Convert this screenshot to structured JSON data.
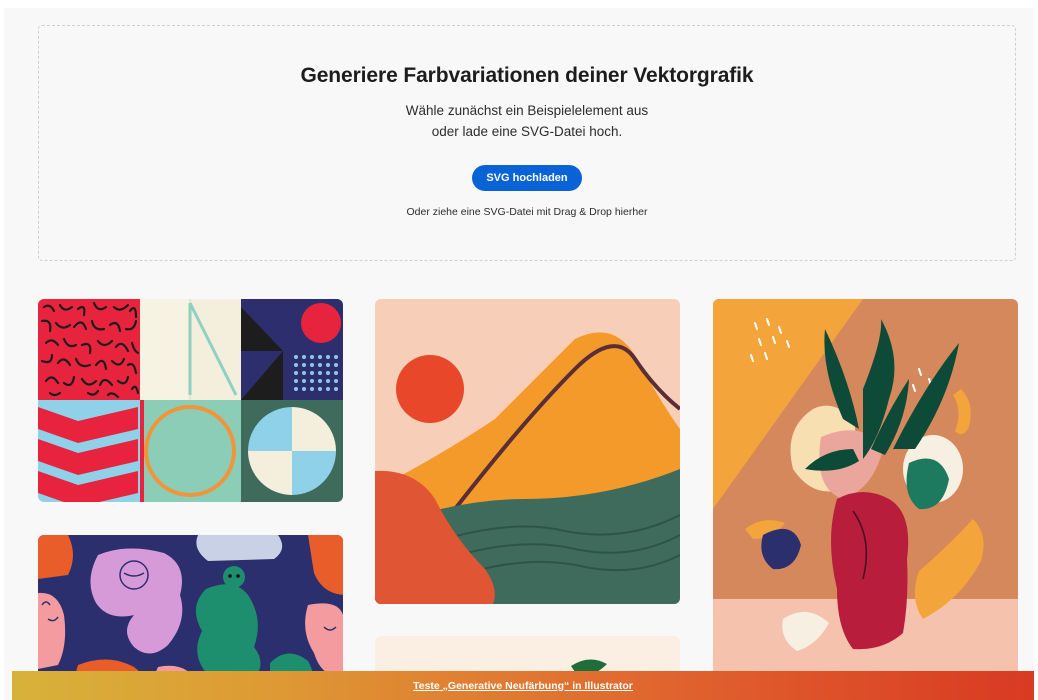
{
  "dropzone": {
    "title": "Generiere Farbvariationen deiner Vektorgrafik",
    "subtitle_line1": "Wähle zunächst ein Beispielelement aus",
    "subtitle_line2": "oder lade eine SVG-Datei hoch.",
    "upload_button": "SVG hochladen",
    "drag_text": "Oder ziehe eine SVG-Datei mit Drag & Drop hierher"
  },
  "colors": {
    "primary_button": "#0a63d6",
    "background": "#f8f8f8"
  },
  "gallery": {
    "tiles": [
      {
        "icon": "geometric-pattern-sample"
      },
      {
        "icon": "people-pattern-sample"
      },
      {
        "icon": "landscape-sample"
      },
      {
        "icon": "partial-sample"
      },
      {
        "icon": "plant-vase-sample"
      }
    ]
  },
  "banner": {
    "link_text": "Teste „Generative Neufärbung“ in Illustrator"
  }
}
